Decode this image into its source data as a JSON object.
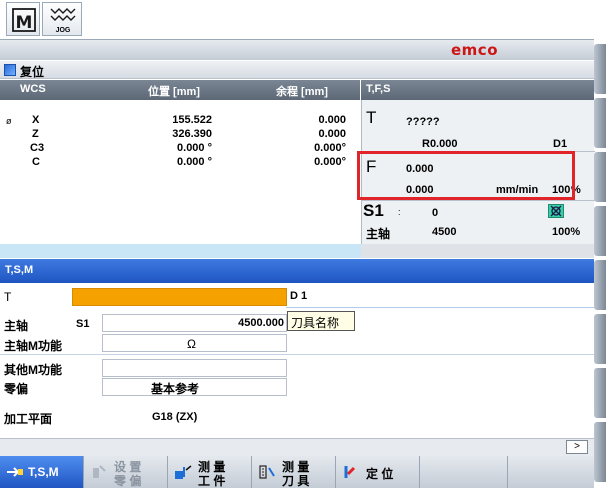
{
  "header": {
    "jog_label": "JOG",
    "brand": "emco",
    "status": "复位"
  },
  "wcs": {
    "title": "WCS",
    "col_position": "位置 [mm]",
    "col_remaining": "余程 [mm]",
    "rows": [
      {
        "prefix": "ø",
        "axis": "X",
        "position": "155.522",
        "remaining": "0.000"
      },
      {
        "prefix": "",
        "axis": "Z",
        "position": "326.390",
        "remaining": "0.000"
      },
      {
        "prefix": "",
        "axis": "C3",
        "position": "0.000 °",
        "remaining": "0.000°"
      },
      {
        "prefix": "",
        "axis": "C",
        "position": "0.000 °",
        "remaining": "0.000°"
      }
    ]
  },
  "tfs": {
    "title": "T,F,S",
    "t_label": "T",
    "t_value": "?????",
    "t_radius": "R0.000",
    "t_d": "D1",
    "f_label": "F",
    "f_value": "0.000",
    "f_actual": "0.000",
    "f_unit": "mm/min",
    "f_percent": "100",
    "f_percent_sign": "%",
    "s_label": "S1",
    "s_value": "0",
    "spindle_label": "主轴",
    "spindle_value": "4500",
    "spindle_percent": "100%"
  },
  "tsm": {
    "title": "T,S,M",
    "t_label": "T",
    "d_label": "D 1",
    "tooltip": "刀具名称",
    "spindle_label": "主轴",
    "spindle_channel": "S1",
    "spindle_value": "4500.000",
    "spindle_m_label": "主轴M功能",
    "rotation_symbol": "Ω",
    "other_m_label": "其他M功能",
    "zero_offset_label": "零偏",
    "zero_offset_value": "基本参考",
    "plane_label": "加工平面",
    "plane_value": "G18 (ZX)"
  },
  "scroll": {
    "label": ">"
  },
  "softkeys": [
    {
      "line1": "T,S,M",
      "line2": ""
    },
    {
      "line1": "设 置",
      "line2": "零 偏"
    },
    {
      "line1": "测 量",
      "line2": "工 件"
    },
    {
      "line1": "测 量",
      "line2": "刀 具"
    },
    {
      "line1": "定 位",
      "line2": ""
    }
  ],
  "colors": {
    "accent_blue": "#1f55c2",
    "highlight_red": "#e0242a",
    "tool_orange": "#f5a100",
    "brand_red": "#cc1515"
  }
}
